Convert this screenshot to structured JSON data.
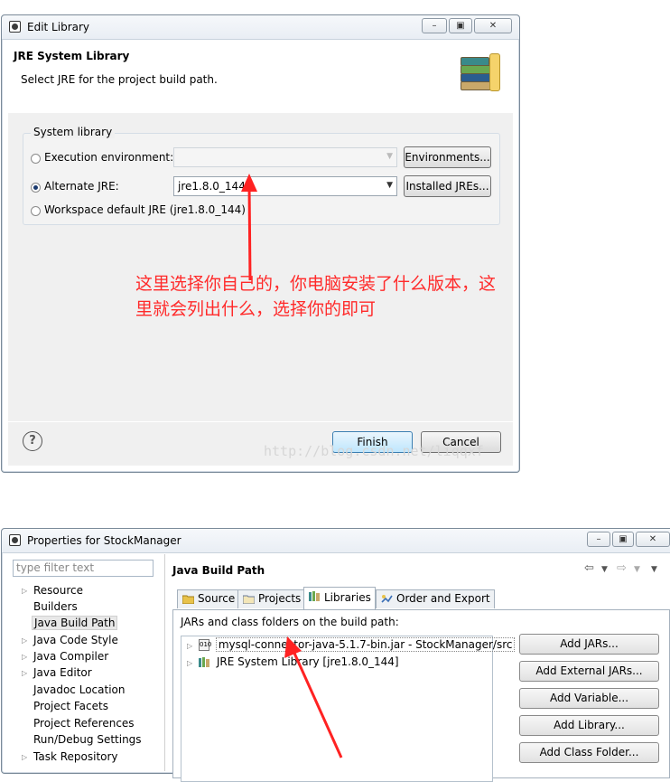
{
  "edit_library": {
    "title": "Edit Library",
    "header_title": "JRE System Library",
    "header_subtitle": "Select JRE for the project build path.",
    "group_label": "System library",
    "options": [
      {
        "label": "Execution environment:",
        "selected": false
      },
      {
        "label": "Alternate JRE:",
        "selected": true
      },
      {
        "label": "Workspace default JRE (jre1.8.0_144)",
        "selected": false
      }
    ],
    "exec_env_value": "",
    "alternate_jre_value": "jre1.8.0_144",
    "environments_button": "Environments...",
    "installed_jres_button": "Installed JREs...",
    "annotation": "这里选择你自己的，你电脑安装了什么版本，这里就会列出什么，选择你的即可",
    "finish_button": "Finish",
    "cancel_button": "Cancel",
    "watermark": "http://blog.csdn.net/liqqxf",
    "help_icon": "?",
    "annotation_color": "#ff2a2a"
  },
  "properties": {
    "title": "Properties for StockManager",
    "filter_placeholder": "type filter text",
    "page_title": "Java Build Path",
    "tree": [
      {
        "label": "Resource",
        "expandable": true
      },
      {
        "label": "Builders",
        "expandable": false
      },
      {
        "label": "Java Build Path",
        "expandable": false,
        "selected": true
      },
      {
        "label": "Java Code Style",
        "expandable": true
      },
      {
        "label": "Java Compiler",
        "expandable": true
      },
      {
        "label": "Java Editor",
        "expandable": true
      },
      {
        "label": "Javadoc Location",
        "expandable": false
      },
      {
        "label": "Project Facets",
        "expandable": false
      },
      {
        "label": "Project References",
        "expandable": false
      },
      {
        "label": "Run/Debug Settings",
        "expandable": false
      },
      {
        "label": "Task Repository",
        "expandable": true
      }
    ],
    "tabs": [
      {
        "label": "Source",
        "icon": "source-folder-icon"
      },
      {
        "label": "Projects",
        "icon": "projects-icon"
      },
      {
        "label": "Libraries",
        "icon": "libraries-icon",
        "active": true
      },
      {
        "label": "Order and Export",
        "icon": "order-export-icon"
      }
    ],
    "list_caption": "JARs and class folders on the build path:",
    "entries": [
      "mysql-connector-java-5.1.7-bin.jar - StockManager/src",
      "JRE System Library [jre1.8.0_144]"
    ],
    "buttons": [
      "Add JARs...",
      "Add External JARs...",
      "Add Variable...",
      "Add Library...",
      "Add Class Folder..."
    ]
  }
}
